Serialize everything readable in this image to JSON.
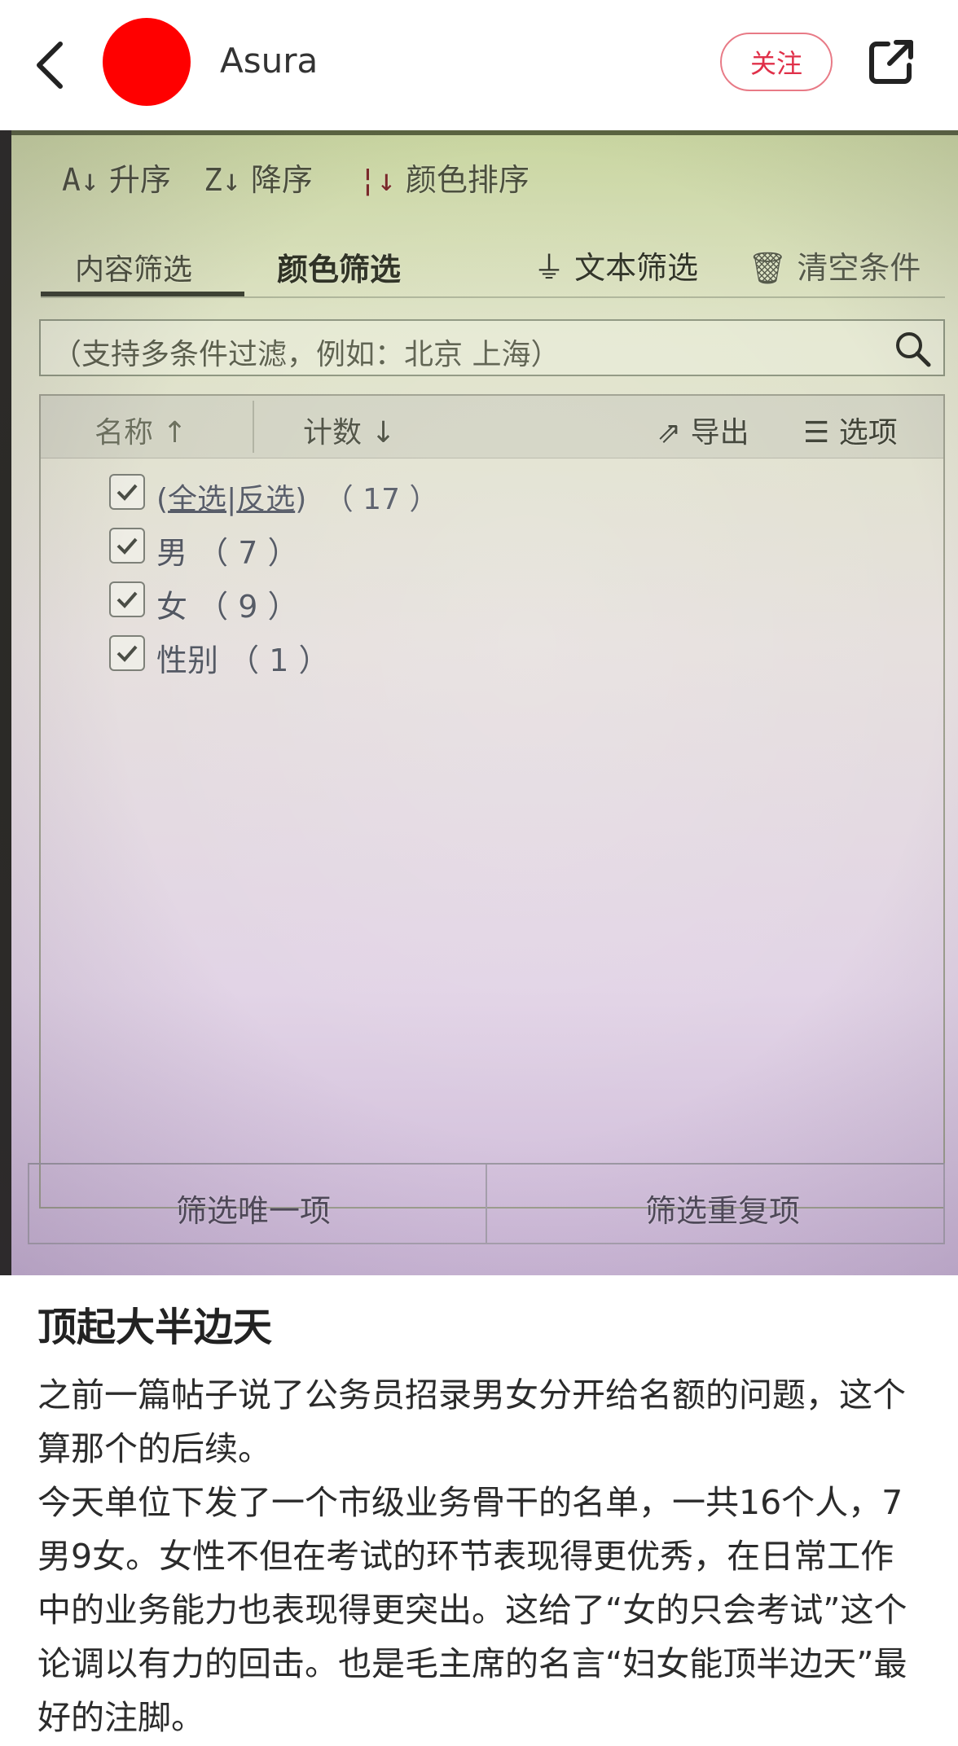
{
  "topbar": {
    "username": "Asura",
    "follow_label": "关注",
    "avatar_color": "#ff0000",
    "follow_color": "#e03049"
  },
  "photo_ui": {
    "sort_buttons": [
      {
        "icon": "sort-ascending-icon",
        "label": "升序"
      },
      {
        "icon": "sort-descending-icon",
        "label": "降序"
      },
      {
        "icon": "color-sort-icon",
        "label": "颜色排序"
      }
    ],
    "tabs": [
      "内容筛选",
      "颜色筛选"
    ],
    "text_filter_label": "文本筛选",
    "clear_label": "清空条件",
    "search_placeholder": "（支持多条件过滤，例如：北京  上海）",
    "columns": {
      "name": "名称",
      "count": "计数"
    },
    "export_label": "导出",
    "options_label": "选项",
    "items": [
      {
        "label_prefix": "(",
        "select_all": "全选",
        "divider": "|",
        "invert": "反选",
        "label_suffix": ")",
        "count": "（ 17 ）",
        "checked": true
      },
      {
        "label": "男",
        "count": "（ 7 ）",
        "checked": true
      },
      {
        "label": "女",
        "count": "（ 9 ）",
        "checked": true
      },
      {
        "label": "性别",
        "count": "（ 1 ）",
        "checked": true
      }
    ],
    "footer": {
      "unique": "筛选唯一项",
      "duplicate": "筛选重复项"
    }
  },
  "post": {
    "title": "顶起大半边天",
    "paragraphs": [
      "之前一篇帖子说了公务员招录男女分开给名额的问题，这个算那个的后续。",
      "今天单位下发了一个市级业务骨干的名单，一共16个人，7男9女。女性不但在考试的环节表现得更优秀，在日常工作中的业务能力也表现得更突出。这给了“女的只会考试”这个论调以有力的回击。也是毛主席的名言“妇女能顶半边天”最好的注脚。"
    ]
  }
}
